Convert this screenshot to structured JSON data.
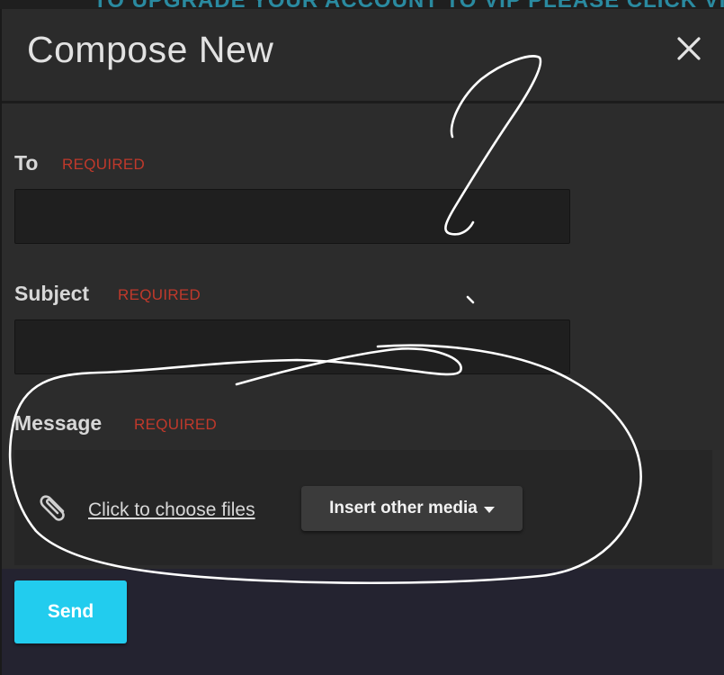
{
  "banner": {
    "text": "TO UPGRADE YOUR ACCOUNT TO VIP PLEASE CLICK VIP"
  },
  "dialog": {
    "title": "Compose New",
    "close_icon": "close-icon"
  },
  "form": {
    "to": {
      "label": "To",
      "required": "REQUIRED",
      "value": "",
      "placeholder": ""
    },
    "subject": {
      "label": "Subject",
      "required": "REQUIRED",
      "value": "",
      "placeholder": ""
    },
    "message": {
      "label": "Message",
      "required": "REQUIRED",
      "attach_icon": "paperclip-icon",
      "choose_files": "Click to choose files",
      "insert_media": "Insert other media"
    }
  },
  "actions": {
    "send": "Send"
  },
  "colors": {
    "accent": "#22ccee",
    "required": "#c0392b",
    "background": "#2c2c2c",
    "annotation": "#ffffff"
  }
}
